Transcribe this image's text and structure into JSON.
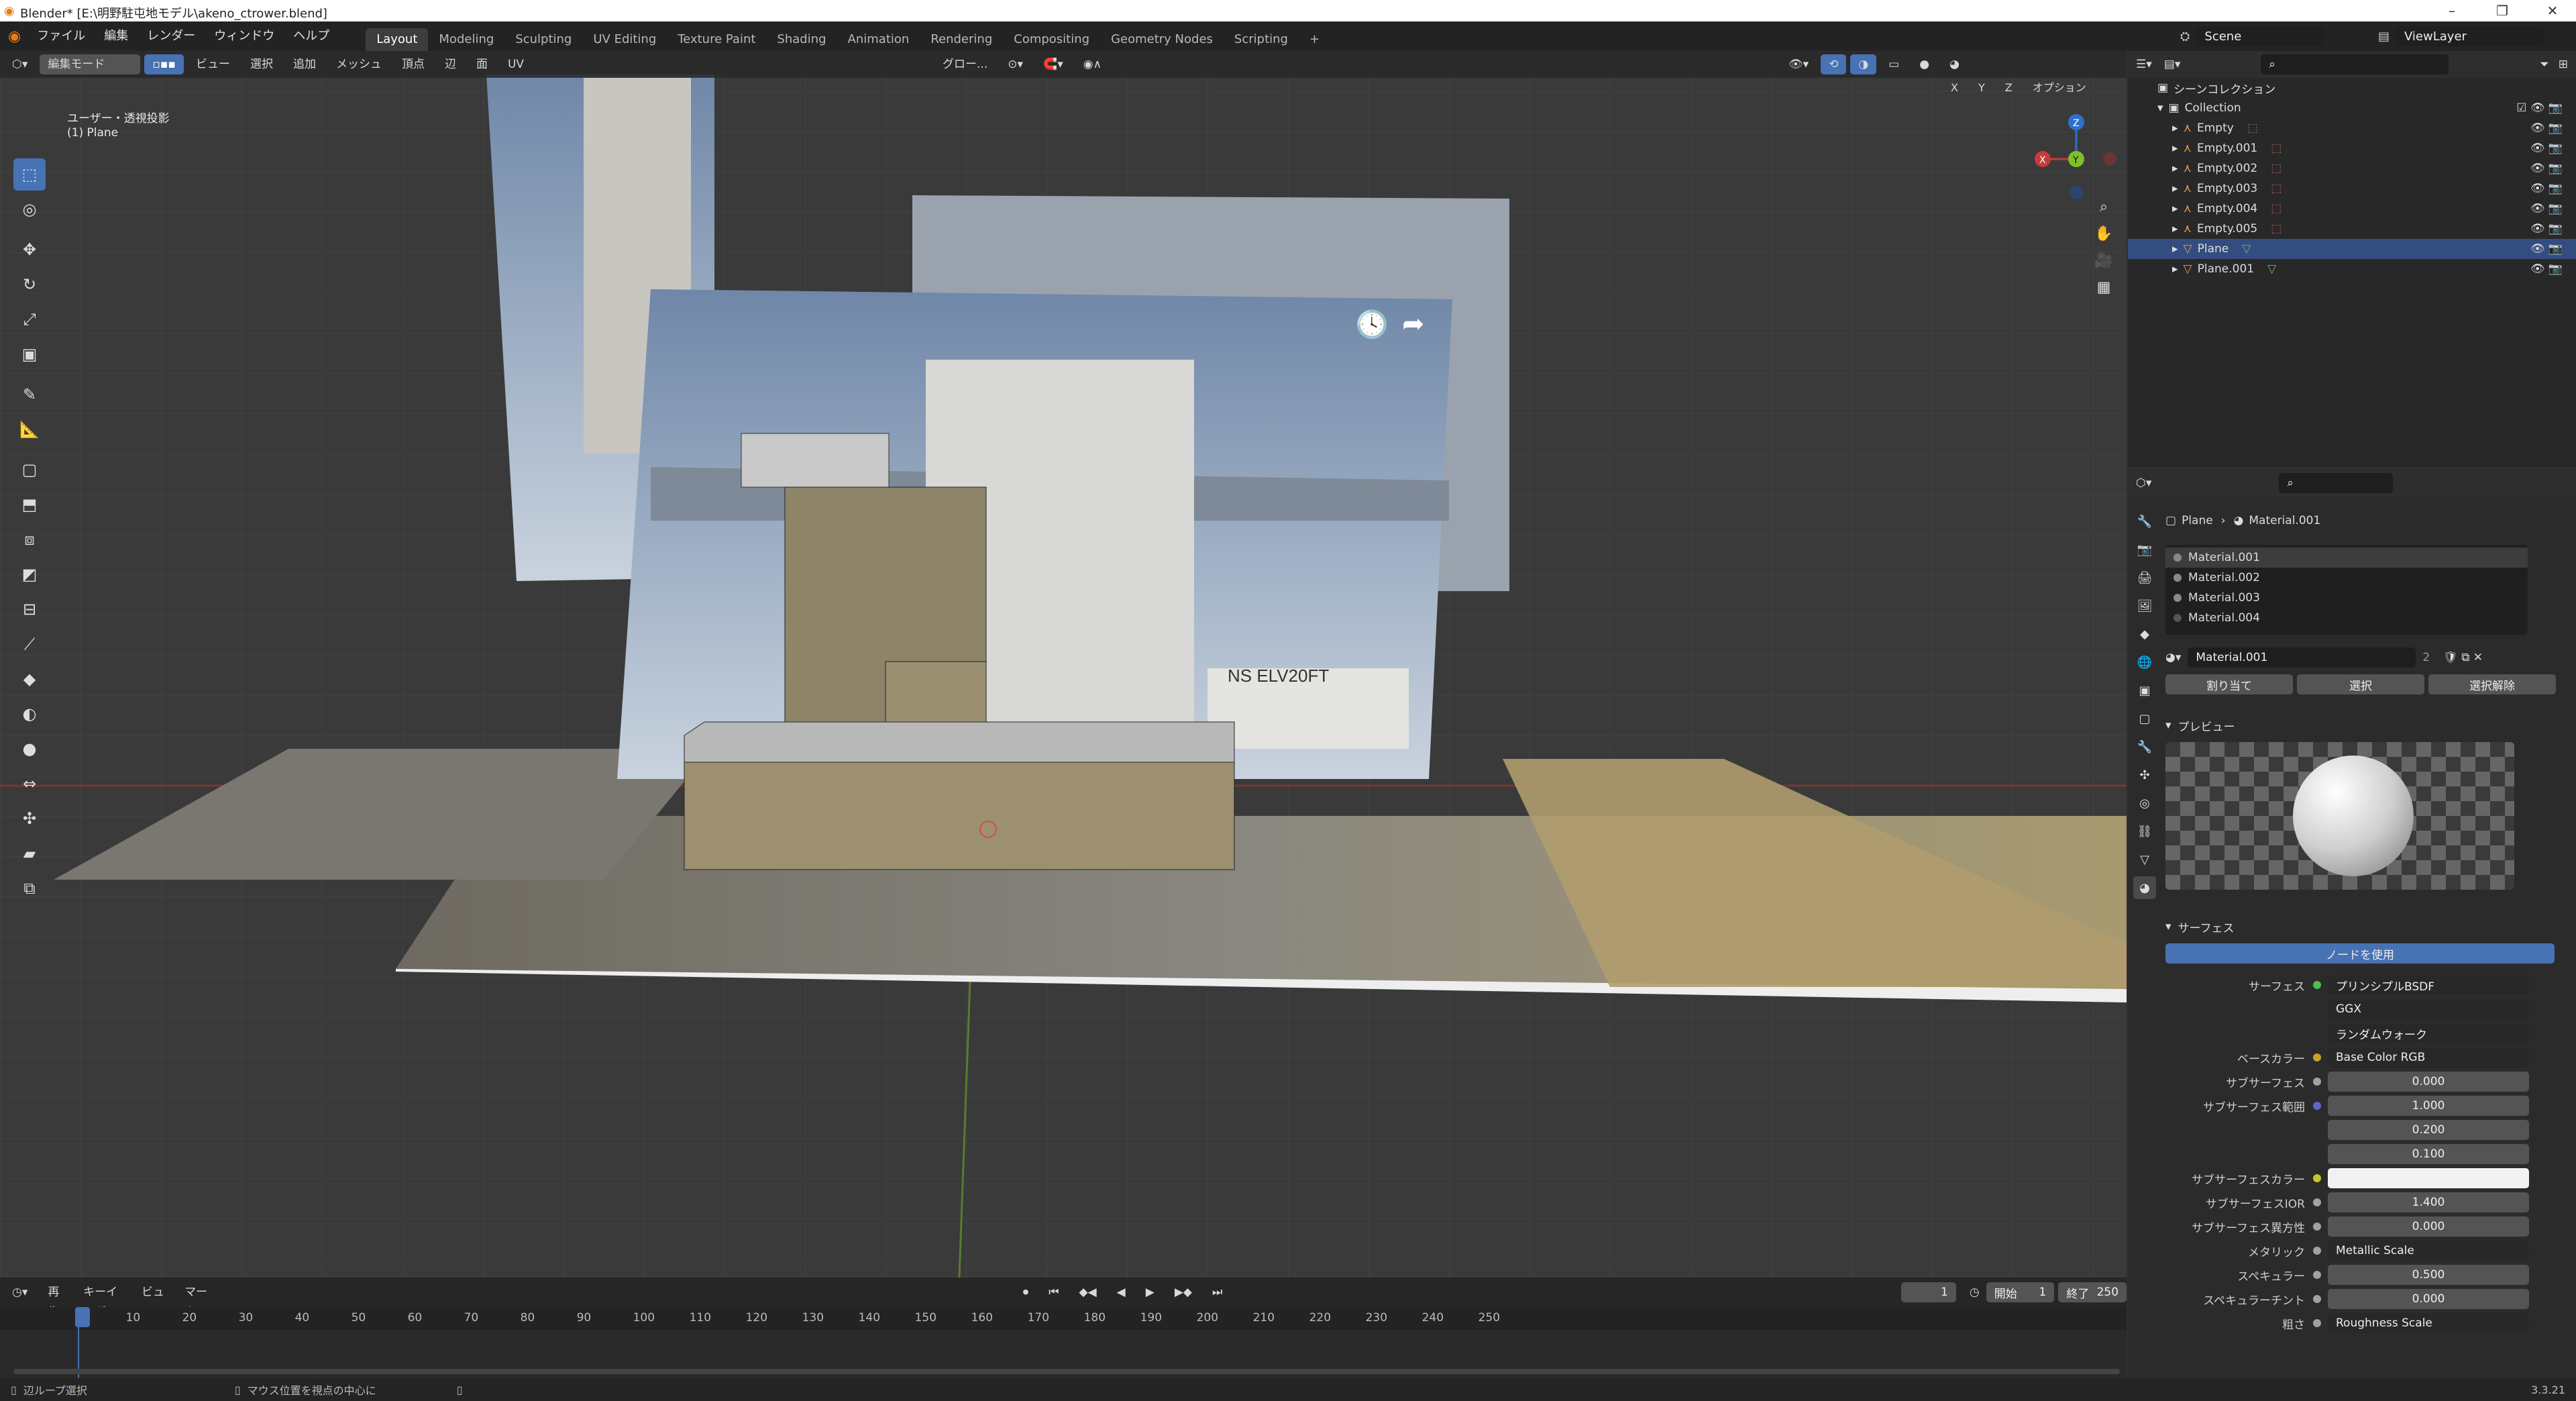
{
  "window": {
    "title": "Blender* [E:\\明野駐屯地モデル\\akeno_ctrower.blend]"
  },
  "menu": [
    "ファイル",
    "編集",
    "レンダー",
    "ウィンドウ",
    "ヘルプ"
  ],
  "workspaces": [
    "Layout",
    "Modeling",
    "Sculpting",
    "UV Editing",
    "Texture Paint",
    "Shading",
    "Animation",
    "Rendering",
    "Compositing",
    "Geometry Nodes",
    "Scripting"
  ],
  "scene": {
    "name": "Scene",
    "view_layer": "ViewLayer"
  },
  "viewport_header": {
    "mode": "編集モード",
    "menus": [
      "ビュー",
      "選択",
      "追加",
      "メッシュ",
      "頂点",
      "辺",
      "面",
      "UV"
    ],
    "transform_orientation": "グロー...",
    "axes": [
      "X",
      "Y",
      "Z"
    ],
    "options": "オプション"
  },
  "viewport_overlay": {
    "view_name": "ユーザー・透視投影",
    "object_name": "(1) Plane",
    "sign_text": "NS ELV20FT"
  },
  "outliner": {
    "scene_collection": "シーンコレクション",
    "collection": "Collection",
    "items": [
      "Empty",
      "Empty.001",
      "Empty.002",
      "Empty.003",
      "Empty.004",
      "Empty.005",
      "Plane",
      "Plane.001"
    ],
    "selected": "Plane"
  },
  "properties": {
    "breadcrumb": {
      "object": "Plane",
      "material": "Material.001"
    },
    "material_slots": [
      "Material.001",
      "Material.002",
      "Material.003",
      "Material.004"
    ],
    "material_name": "Material.001",
    "user_count": "2",
    "slot_buttons": [
      "割り当て",
      "選択",
      "選択解除"
    ],
    "preview_header": "プレビュー",
    "surface_header": "サーフェス",
    "use_nodes": "ノードを使用",
    "rows": [
      {
        "label": "サーフェス",
        "value": "プリンシプルBSDF",
        "color": "#4fbf4f"
      },
      {
        "label": "",
        "value": "GGX"
      },
      {
        "label": "",
        "value": "ランダムウォーク"
      },
      {
        "label": "ベースカラー",
        "value": "Base Color RGB",
        "color": "#c7a229"
      },
      {
        "label": "サブサーフェス",
        "value": "0.000",
        "color": "#a1a1a1"
      },
      {
        "label": "サブサーフェス範囲",
        "value": "1.000",
        "color": "#6363c7"
      },
      {
        "label": "",
        "value": "0.200"
      },
      {
        "label": "",
        "value": "0.100"
      },
      {
        "label": "サブサーフェスカラー",
        "value": "",
        "color": "#c7c729"
      },
      {
        "label": "サブサーフェスIOR",
        "value": "1.400",
        "color": "#a1a1a1"
      },
      {
        "label": "サブサーフェス異方性",
        "value": "0.000",
        "color": "#a1a1a1"
      },
      {
        "label": "メタリック",
        "value": "Metallic Scale",
        "color": "#a1a1a1"
      },
      {
        "label": "スペキュラー",
        "value": "0.500",
        "color": "#a1a1a1"
      },
      {
        "label": "スペキュラーチント",
        "value": "0.000",
        "color": "#a1a1a1"
      },
      {
        "label": "粗さ",
        "value": "Roughness Scale",
        "color": "#a1a1a1"
      }
    ]
  },
  "timeline": {
    "menus": [
      "再生",
      "キーイング",
      "ビュー",
      "マーカー"
    ],
    "current_frame": "1",
    "start_label": "開始",
    "start": "1",
    "end_label": "終了",
    "end": "250",
    "ticks": [
      "1",
      "10",
      "20",
      "30",
      "40",
      "50",
      "60",
      "70",
      "80",
      "90",
      "100",
      "110",
      "120",
      "130",
      "140",
      "150",
      "160",
      "170",
      "180",
      "190",
      "200",
      "210",
      "220",
      "230",
      "240",
      "250"
    ]
  },
  "statusbar": {
    "left": "辺ループ選択",
    "middle": "マウス位置を視点の中心に",
    "version": "3.3.21"
  },
  "colors": {
    "accent": "#4772b3",
    "selection": "#334d80",
    "header": "#232323",
    "panel": "#2b2b2b"
  }
}
